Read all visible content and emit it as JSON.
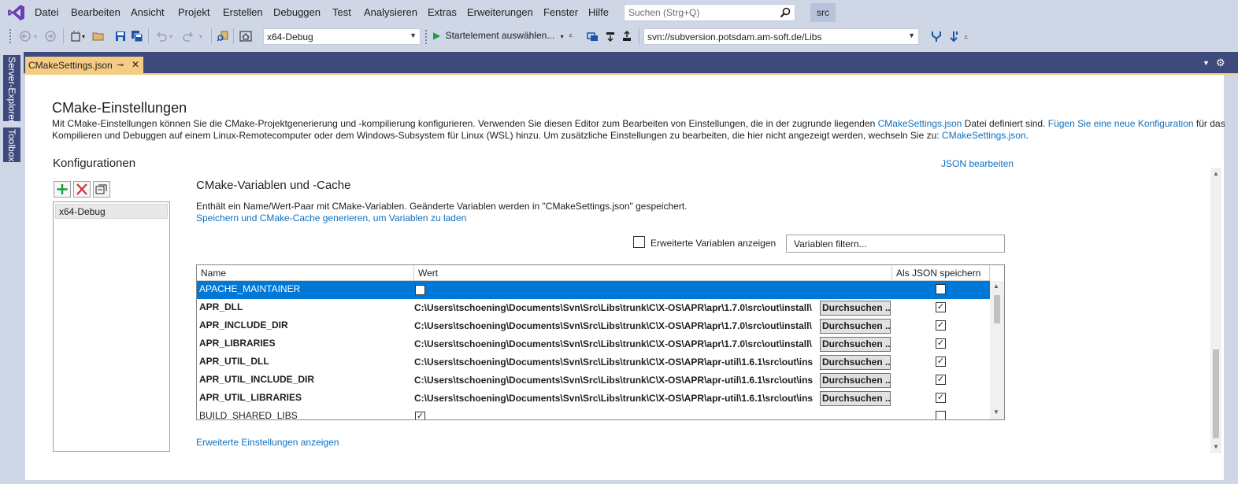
{
  "menu": {
    "items": [
      "Datei",
      "Bearbeiten",
      "Ansicht",
      "Projekt",
      "Erstellen",
      "Debuggen",
      "Test",
      "Analysieren",
      "Extras",
      "Erweiterungen",
      "Fenster",
      "Hilfe"
    ],
    "search_placeholder": "Suchen (Strg+Q)",
    "solution_badge": "src"
  },
  "toolbar": {
    "config_value": "x64-Debug",
    "start_label": "Startelement auswählen...",
    "repo_url": "svn://subversion.potsdam.am-soft.de/Libs"
  },
  "side_tabs": [
    "Server-Explorer",
    "Toolbox"
  ],
  "doc_tab": {
    "title": "CMakeSettings.json",
    "pin": "⊸",
    "close": "✕"
  },
  "page": {
    "title": "CMake-Einstellungen",
    "desc_line1_a": "Mit CMake-Einstellungen können Sie die CMake-Projektgenerierung und -kompilierung konfigurieren. Verwenden Sie diesen Editor zum Bearbeiten von Einstellungen, die in der zugrunde liegenden ",
    "desc_line1_link1": "CMakeSettings.json",
    "desc_line1_b": " Datei definiert sind. ",
    "desc_line1_link2": "Fügen Sie eine neue Konfiguration",
    "desc_line1_c": " für das",
    "desc_line2_a": "Kompilieren und Debuggen auf einem Linux-Remotecomputer oder dem Windows-Subsystem für Linux (WSL) hinzu. Um zusätzliche Einstellungen zu bearbeiten, die hier nicht angezeigt werden, wechseln Sie zu: ",
    "desc_line2_link": "CMakeSettings.json",
    "desc_line2_b": "."
  },
  "configurations": {
    "title": "Konfigurationen",
    "items": [
      "x64-Debug"
    ]
  },
  "json_edit_link": "JSON bearbeiten",
  "variables": {
    "title": "CMake-Variablen und -Cache",
    "desc": "Enthält ein Name/Wert-Paar mit CMake-Variablen. Geänderte Variablen werden in \"CMakeSettings.json\" gespeichert.",
    "generate_link": "Speichern und CMake-Cache generieren, um Variablen zu laden",
    "advanced_checkbox_label": "Erweiterte Variablen anzeigen",
    "filter_placeholder": "Variablen filtern...",
    "columns": [
      "Name",
      "Wert",
      "Als JSON speichern"
    ],
    "browse_label": "Durchsuchen ...",
    "rows": [
      {
        "name": "APACHE_MAINTAINER",
        "value": "",
        "value_is_check": true,
        "value_checked": false,
        "json": false,
        "bold": false,
        "selected": true
      },
      {
        "name": "APR_DLL",
        "value": "C:\\Users\\tschoening\\Documents\\Svn\\Src\\Libs\\trunk\\C\\X-OS\\APR\\apr\\1.7.0\\src\\out\\install\\",
        "value_is_check": false,
        "json": true,
        "bold": true,
        "selected": false
      },
      {
        "name": "APR_INCLUDE_DIR",
        "value": "C:\\Users\\tschoening\\Documents\\Svn\\Src\\Libs\\trunk\\C\\X-OS\\APR\\apr\\1.7.0\\src\\out\\install\\",
        "value_is_check": false,
        "json": true,
        "bold": true,
        "selected": false
      },
      {
        "name": "APR_LIBRARIES",
        "value": "C:\\Users\\tschoening\\Documents\\Svn\\Src\\Libs\\trunk\\C\\X-OS\\APR\\apr\\1.7.0\\src\\out\\install\\",
        "value_is_check": false,
        "json": true,
        "bold": true,
        "selected": false
      },
      {
        "name": "APR_UTIL_DLL",
        "value": "C:\\Users\\tschoening\\Documents\\Svn\\Src\\Libs\\trunk\\C\\X-OS\\APR\\apr-util\\1.6.1\\src\\out\\ins",
        "value_is_check": false,
        "json": true,
        "bold": true,
        "selected": false
      },
      {
        "name": "APR_UTIL_INCLUDE_DIR",
        "value": "C:\\Users\\tschoening\\Documents\\Svn\\Src\\Libs\\trunk\\C\\X-OS\\APR\\apr-util\\1.6.1\\src\\out\\ins",
        "value_is_check": false,
        "json": true,
        "bold": true,
        "selected": false
      },
      {
        "name": "APR_UTIL_LIBRARIES",
        "value": "C:\\Users\\tschoening\\Documents\\Svn\\Src\\Libs\\trunk\\C\\X-OS\\APR\\apr-util\\1.6.1\\src\\out\\ins",
        "value_is_check": false,
        "json": true,
        "bold": true,
        "selected": false
      },
      {
        "name": "BUILD_SHARED_LIBS",
        "value": "",
        "value_is_check": true,
        "value_checked": true,
        "json": false,
        "bold": false,
        "selected": false
      }
    ]
  },
  "advanced_settings_link": "Erweiterte Einstellungen anzeigen",
  "colors": {
    "accent": "#0078d7",
    "tab_active": "#f5cc84",
    "link": "#0e70c0",
    "chrome": "#cfd6e5"
  }
}
